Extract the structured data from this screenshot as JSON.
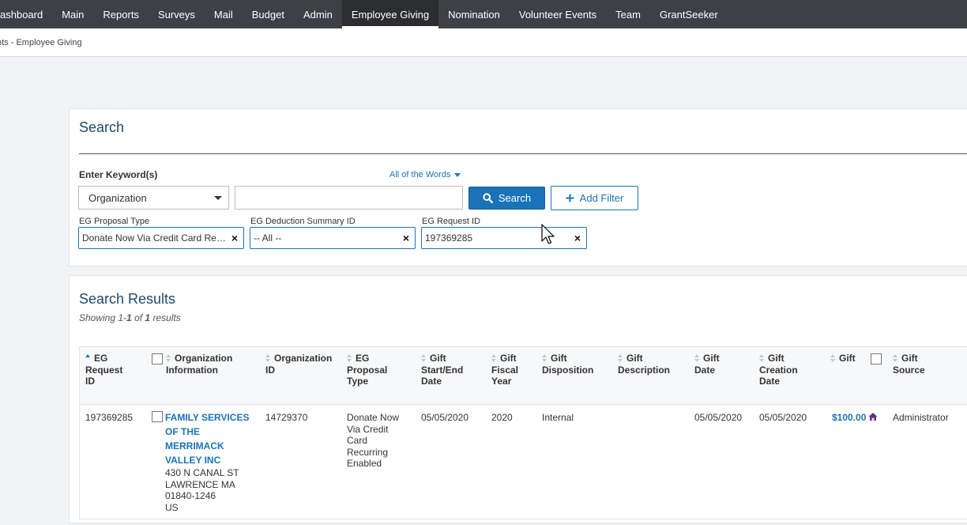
{
  "nav": {
    "items": [
      "ashboard",
      "Main",
      "Reports",
      "Surveys",
      "Mail",
      "Budget",
      "Admin",
      "Employee Giving",
      "Nomination",
      "Volunteer Events",
      "Team",
      "GrantSeeker"
    ],
    "active_index": 7
  },
  "breadcrumb": "nts - Employee Giving",
  "search": {
    "title": "Search",
    "keyword_label": "Enter Keyword(s)",
    "match_mode": "All of the Words",
    "field_select": "Organization",
    "keyword_value": "",
    "search_button": "Search",
    "add_filter_button": "Add Filter",
    "filters": [
      {
        "label": "EG Proposal Type",
        "value": "Donate Now Via Credit Card Recurring Enabled"
      },
      {
        "label": "EG Deduction Summary ID",
        "value": "-- All --"
      },
      {
        "label": "EG Request ID",
        "value": "197369285"
      }
    ]
  },
  "results": {
    "title": "Search Results",
    "showing_prefix": "Showing 1-",
    "showing_to": "1",
    "showing_of": " of ",
    "showing_total": "1",
    "showing_suffix": " results",
    "columns": {
      "request_id": [
        "EG",
        "Request",
        "ID"
      ],
      "org_info": [
        "Organization",
        "Information"
      ],
      "org_id": [
        "Organization",
        "ID"
      ],
      "proposal_type": [
        "EG",
        "Proposal",
        "Type"
      ],
      "gift_dates": [
        "Gift",
        "Start/End",
        "Date"
      ],
      "fiscal_year": [
        "Gift",
        "Fiscal",
        "Year"
      ],
      "disposition": [
        "Gift",
        "Disposition"
      ],
      "description": [
        "Gift",
        "Description"
      ],
      "gift_date": [
        "Gift",
        "Date"
      ],
      "creation_date": [
        "Gift",
        "Creation",
        "Date"
      ],
      "gift": [
        "Gift"
      ],
      "source": [
        "Gift",
        "Source"
      ]
    },
    "row": {
      "request_id": "197369285",
      "org_name": [
        "FAMILY SERVICES",
        "OF THE",
        "MERRIMACK",
        "VALLEY INC"
      ],
      "address": [
        "430 N CANAL ST",
        "LAWRENCE MA",
        "01840-1246",
        "US"
      ],
      "org_id": "14729370",
      "proposal_type": [
        "Donate Now",
        "Via Credit",
        "Card",
        "Recurring",
        "Enabled"
      ],
      "start_end_date": "05/05/2020",
      "fiscal_year": "2020",
      "disposition": "Internal",
      "description": "",
      "gift_date": "05/05/2020",
      "creation_date": "05/05/2020",
      "amount": "$100.00",
      "source": "Administrator"
    }
  },
  "colors": {
    "nav_bg": "#3d4044",
    "accent": "#1a73b8",
    "title": "#1d4a6b",
    "house_icon": "#6a2c8a"
  }
}
